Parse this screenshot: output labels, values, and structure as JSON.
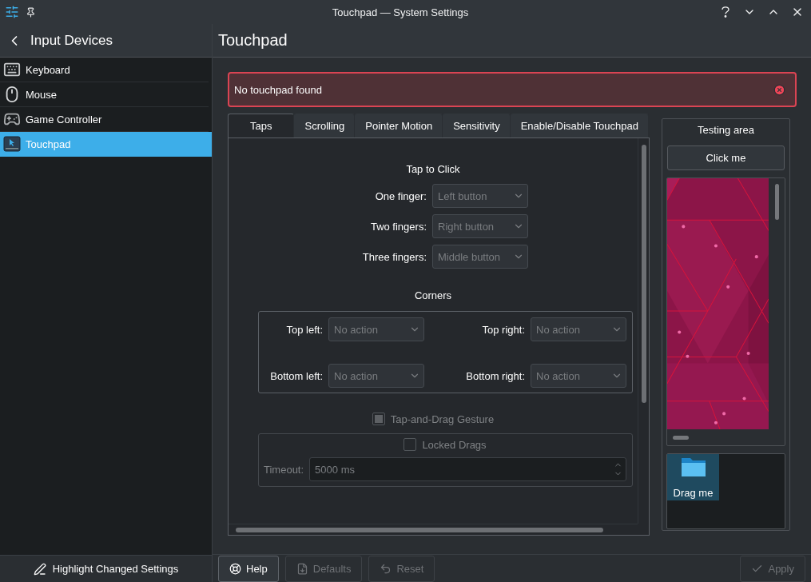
{
  "window": {
    "title": "Touchpad — System Settings"
  },
  "sidebar": {
    "header": "Input Devices",
    "items": [
      {
        "label": "Keyboard",
        "kind": "keyboard",
        "selected": false
      },
      {
        "label": "Mouse",
        "kind": "mouse",
        "selected": false
      },
      {
        "label": "Game Controller",
        "kind": "gamepad",
        "selected": false
      },
      {
        "label": "Touchpad",
        "kind": "touchpad",
        "selected": true
      }
    ],
    "footer_button": "Highlight Changed Settings"
  },
  "page": {
    "title": "Touchpad"
  },
  "error_banner": {
    "message": "No touchpad found"
  },
  "tabs": [
    {
      "label": "Taps",
      "selected": true
    },
    {
      "label": "Scrolling",
      "selected": false
    },
    {
      "label": "Pointer Motion",
      "selected": false
    },
    {
      "label": "Sensitivity",
      "selected": false
    },
    {
      "label": "Enable/Disable Touchpad",
      "selected": false
    }
  ],
  "tap_to_click": {
    "heading": "Tap to Click",
    "rows": [
      {
        "label": "One finger:",
        "value": "Left button",
        "disabled": true
      },
      {
        "label": "Two fingers:",
        "value": "Right button",
        "disabled": true
      },
      {
        "label": "Three fingers:",
        "value": "Middle button",
        "disabled": true
      }
    ]
  },
  "corners": {
    "heading": "Corners",
    "rows": [
      {
        "label": "Top left:",
        "value": "No action",
        "disabled": true
      },
      {
        "label": "Top right:",
        "value": "No action",
        "disabled": true
      },
      {
        "label": "Bottom left:",
        "value": "No action",
        "disabled": true
      },
      {
        "label": "Bottom right:",
        "value": "No action",
        "disabled": true
      }
    ]
  },
  "tap_and_drag": {
    "label": "Tap-and-Drag Gesture",
    "checked": true,
    "disabled": true
  },
  "locked_drags": {
    "label": "Locked Drags",
    "checked": false,
    "disabled": true
  },
  "timeout": {
    "label": "Timeout:",
    "value": "5000 ms",
    "disabled": true
  },
  "testing_area": {
    "title": "Testing area",
    "button": "Click me",
    "drag_item": {
      "label": "Drag me",
      "selected": true
    }
  },
  "buttons": [
    {
      "label": "Help",
      "kind": "help",
      "disabled": false
    },
    {
      "label": "Defaults",
      "kind": "defaults",
      "disabled": true
    },
    {
      "label": "Reset",
      "kind": "reset",
      "disabled": true
    },
    {
      "label": "Apply",
      "kind": "apply",
      "disabled": true
    }
  ]
}
